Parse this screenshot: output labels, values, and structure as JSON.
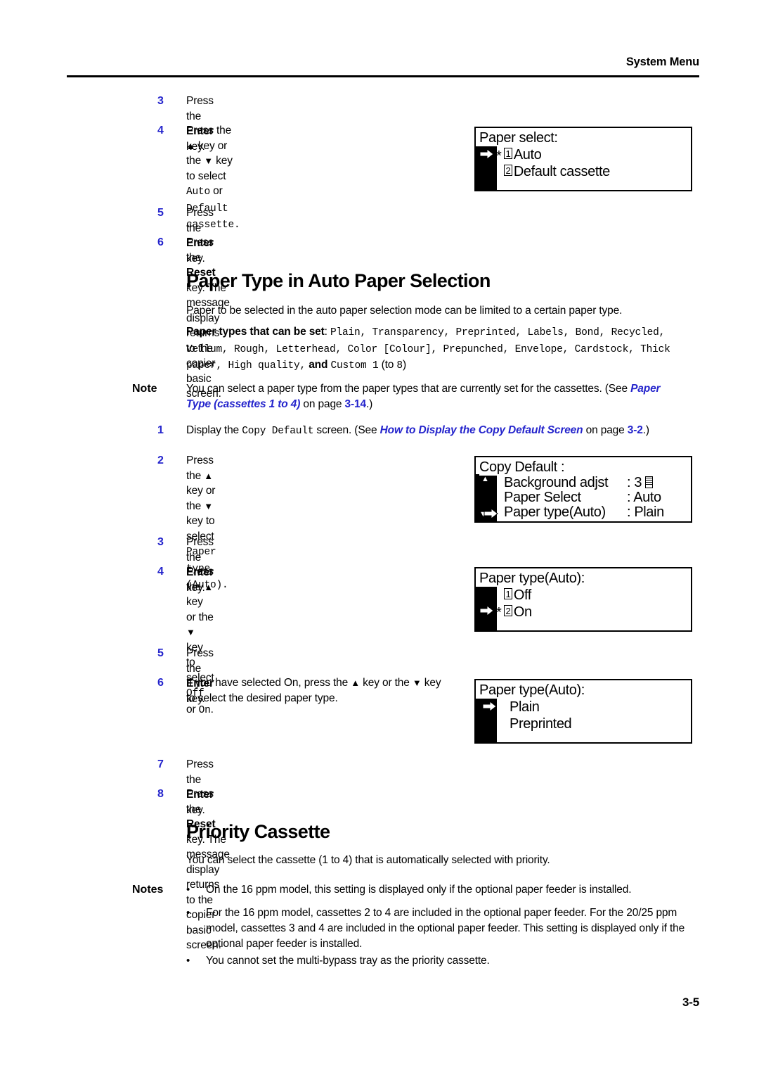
{
  "header": {
    "running_head": "System Menu"
  },
  "footer": {
    "page_number": "3-5"
  },
  "steps_group_1": [
    {
      "num": "3",
      "text_parts": {
        "pre": "Press the ",
        "key": "Enter",
        "post": " key."
      }
    },
    {
      "num": "4",
      "line1_pre": "Press the ",
      "line1_mid": " key or the ",
      "line1_post": " key to select ",
      "line1_mono": "Auto",
      "line1_or": " or",
      "line2_mono": "Default cassette."
    },
    {
      "num": "5",
      "text_parts": {
        "pre": "Press the ",
        "key": "Enter",
        "post": " key."
      }
    },
    {
      "num": "6",
      "text_parts": {
        "pre": "Press the ",
        "key": "Reset",
        "post": " key. The message display returns to the copier basic screen."
      }
    }
  ],
  "section_paper_type": {
    "heading": "Paper Type in Auto Paper Selection",
    "intro": "Paper to be selected in the auto paper selection mode can be limited to a certain paper type.",
    "types_label": "Paper types that can be set",
    "types_colon": ":",
    "types_line1": "Plain, Transparency, Preprinted, Labels, Bond, Recycled,",
    "types_line2": "Vellum, Rough, Letterhead, Color [Colour], Prepunched, Envelope, Cardstock, Thick",
    "types_line3_mono_a": "paper, High quality,",
    "types_line3_and": " and ",
    "types_line3_mono_b": "Custom 1",
    "types_line3_tail_open": " (to ",
    "types_line3_mono_c": "8",
    "types_line3_tail_close": ")"
  },
  "note_block": {
    "label": "Note",
    "line1": "You can select a paper type from the paper types that are currently set for the cassettes. (See",
    "xref": "Paper Type (cassettes 1 to 4)",
    "on_page": " on page ",
    "page": "3-14",
    "tail": ".)"
  },
  "steps_group_2": [
    {
      "num": "1",
      "pre": "Display the ",
      "mono": "Copy Default",
      "mid": " screen. (See ",
      "xref": "How to Display the Copy Default Screen",
      "on_page": " on page ",
      "page": "3-2",
      "tail": ".)"
    },
    {
      "num": "2",
      "line1_pre": "Press the ",
      "line1_mid": " key or the ",
      "line1_post": " key to select ",
      "line1_mono": "Paper type",
      "line2_mono": "(Auto)."
    },
    {
      "num": "3",
      "text_parts": {
        "pre": "Press the ",
        "key": "Enter",
        "post": " key."
      }
    },
    {
      "num": "4",
      "pre": "Press the ",
      "mid": " key or the ",
      "post": " key to select ",
      "mono_a": "Off",
      "or": " or ",
      "mono_b": "On",
      "tail": "."
    },
    {
      "num": "5",
      "text_parts": {
        "pre": "Press the ",
        "key": "Enter",
        "post": " key."
      }
    },
    {
      "num": "6",
      "line1_a": "If you have selected On, press the ",
      "line1_b": " key or the ",
      "line1_c": " key",
      "line2": "to select the desired paper type."
    },
    {
      "num": "7",
      "text_parts": {
        "pre": "Press the ",
        "key": "Enter",
        "post": " key."
      }
    },
    {
      "num": "8",
      "text_parts": {
        "pre": "Press the ",
        "key": "Reset",
        "post": " key. The message display returns to the copier basic screen."
      }
    }
  ],
  "section_priority": {
    "heading": "Priority Cassette",
    "intro": "You can select the cassette (1 to 4) that is automatically selected with priority.",
    "notes_label": "Notes",
    "bullets": [
      "On the 16 ppm model, this setting is displayed only if the optional paper feeder is installed.",
      "For the 16 ppm model, cassettes 2 to 4 are included in the optional paper feeder. For the 20/25 ppm model, cassettes 3 and 4 are included in the optional paper feeder. This setting is displayed only if the optional paper feeder is installed.",
      "You cannot set the multi-bypass tray as the priority cassette."
    ]
  },
  "lcd_screens": {
    "paper_select": {
      "title": "Paper select:",
      "items": [
        {
          "index": "1",
          "label": "Auto",
          "selected": true,
          "cursor": true
        },
        {
          "index": "2",
          "label": "Default cassette",
          "selected": false,
          "cursor": false
        }
      ]
    },
    "copy_default": {
      "title": "Copy Default :",
      "rows": [
        {
          "label": "Background adjst",
          "value": ": 3",
          "icon": "background-adjust-icon",
          "cursor": false
        },
        {
          "label": "Paper Select",
          "value": ": Auto",
          "cursor": false
        },
        {
          "label": "Paper type(Auto)",
          "value": ": Plain",
          "cursor": true
        }
      ],
      "scroll_up": "▲",
      "scroll_down": "▼"
    },
    "paper_type_onoff": {
      "title": "Paper type(Auto):",
      "items": [
        {
          "index": "1",
          "label": "Off",
          "selected": false,
          "cursor": false
        },
        {
          "index": "2",
          "label": "On",
          "selected": true,
          "cursor": true
        }
      ]
    },
    "paper_type_list": {
      "title": "Paper type(Auto):",
      "items": [
        {
          "label": "Plain",
          "cursor": true
        },
        {
          "label": "Preprinted",
          "cursor": false
        }
      ]
    }
  },
  "glyphs": {
    "up_triangle": "▲",
    "down_triangle": "▼",
    "bullet": "•",
    "asterisk": "*"
  },
  "colors": {
    "accent_blue": "#2424cc",
    "text": "#000000"
  }
}
